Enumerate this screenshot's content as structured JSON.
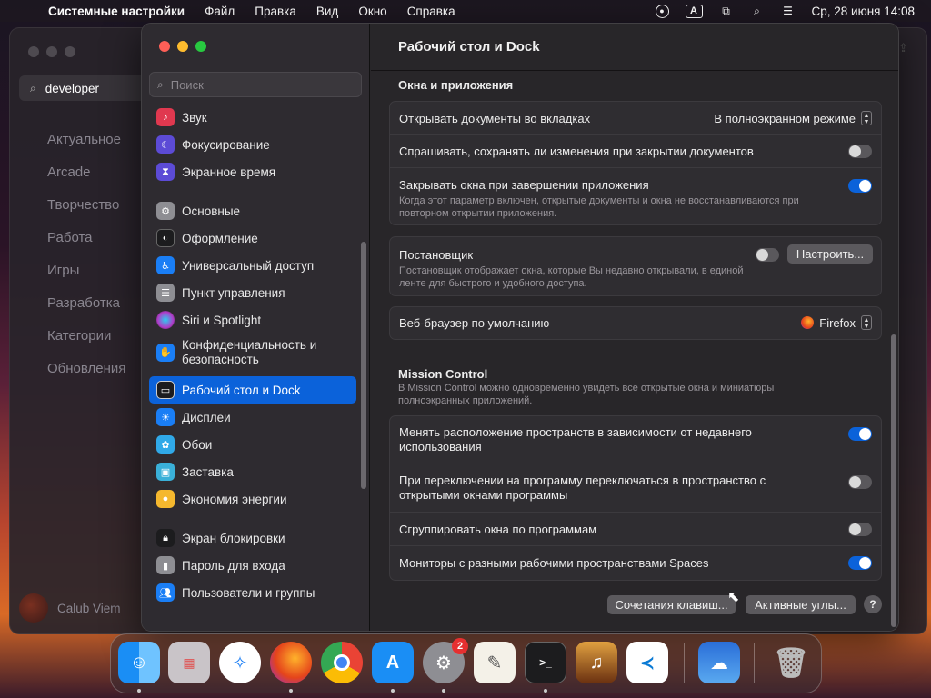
{
  "menubar": {
    "app_name": "Системные настройки",
    "items": [
      "Файл",
      "Правка",
      "Вид",
      "Окно",
      "Справка"
    ],
    "clock": "Ср, 28 июня  14:08",
    "input_source": "A"
  },
  "background_window": {
    "search_value": "developer",
    "nav": [
      "Актуальное",
      "Arcade",
      "Творчество",
      "Работа",
      "Игры",
      "Разработка",
      "Категории",
      "Обновления"
    ],
    "user_name": "Calub Viem"
  },
  "sidebar": {
    "search_placeholder": "Поиск",
    "items": [
      {
        "label": "Звук",
        "icon": "speaker-icon",
        "color": "#e0384f"
      },
      {
        "label": "Фокусирование",
        "icon": "moon-icon",
        "color": "#5c4bd6"
      },
      {
        "label": "Экранное время",
        "icon": "hourglass-icon",
        "color": "#5c4bd6"
      },
      {
        "label": "Основные",
        "icon": "gear-icon",
        "color": "#8e8e93"
      },
      {
        "label": "Оформление",
        "icon": "appearance-icon",
        "color": "#1c1c1e"
      },
      {
        "label": "Универсальный доступ",
        "icon": "accessibility-icon",
        "color": "#1a7ef5"
      },
      {
        "label": "Пункт управления",
        "icon": "control-center-icon",
        "color": "#8e8e93"
      },
      {
        "label": "Siri и Spotlight",
        "icon": "siri-icon",
        "color": "#b03cc8"
      },
      {
        "label": "Конфиденциальность и безопасность",
        "icon": "hand-icon",
        "color": "#1a7ef5"
      },
      {
        "label": "Рабочий стол и Dock",
        "icon": "desktop-dock-icon",
        "color": "#1c1c1e"
      },
      {
        "label": "Дисплеи",
        "icon": "sun-icon",
        "color": "#1a7ef5"
      },
      {
        "label": "Обои",
        "icon": "flower-icon",
        "color": "#30a9e8"
      },
      {
        "label": "Заставка",
        "icon": "screensaver-icon",
        "color": "#3ab0d8"
      },
      {
        "label": "Экономия энергии",
        "icon": "bulb-icon",
        "color": "#f5b82e"
      },
      {
        "label": "Экран блокировки",
        "icon": "lock-icon",
        "color": "#1c1c1e"
      },
      {
        "label": "Пароль для входа",
        "icon": "password-lock-icon",
        "color": "#8e8e93"
      },
      {
        "label": "Пользователи и группы",
        "icon": "users-icon",
        "color": "#1a7ef5"
      }
    ]
  },
  "content": {
    "title": "Рабочий стол и Dock",
    "windows_section": {
      "title": "Окна и приложения",
      "open_docs_tabs_label": "Открывать документы во вкладках",
      "open_docs_tabs_value": "В полноэкранном режиме",
      "ask_keep_changes_label": "Спрашивать, сохранять ли изменения при закрытии документов",
      "ask_keep_changes_on": false,
      "close_windows_label": "Закрывать окна при завершении приложения",
      "close_windows_desc": "Когда этот параметр включен, открытые документы и окна не восстанавливаются при повторном открытии приложения.",
      "close_windows_on": true
    },
    "stage_manager": {
      "label": "Постановщик",
      "desc": "Постановщик отображает окна, которые Вы недавно открывали, в единой ленте для быстрого и удобного доступа.",
      "on": false,
      "customize_button": "Настроить..."
    },
    "browser": {
      "label": "Веб-браузер по умолчанию",
      "value": "Firefox"
    },
    "mission_control": {
      "title": "Mission Control",
      "desc": "В Mission Control можно одновременно увидеть все открытые окна и миниатюры полноэкранных приложений.",
      "rows": [
        {
          "label": "Менять расположение пространств в зависимости от недавнего использования",
          "on": true
        },
        {
          "label": "При переключении на программу переключаться в пространство с открытыми окнами программы",
          "on": false
        },
        {
          "label": "Сгруппировать окна по программам",
          "on": false
        },
        {
          "label": "Мониторы с разными рабочими пространствами Spaces",
          "on": true
        }
      ]
    },
    "shortcuts_button": "Сочетания клавиш...",
    "hot_corners_button": "Активные углы...",
    "help_button": "?"
  },
  "dock": {
    "apps": [
      "Finder",
      "Launchpad",
      "Safari",
      "Firefox",
      "Chrome",
      "App Store",
      "System Settings",
      "TextEdit",
      "Terminal",
      "GarageBand",
      "VS Code",
      "Weather",
      "Trash"
    ],
    "settings_badge": "2"
  }
}
